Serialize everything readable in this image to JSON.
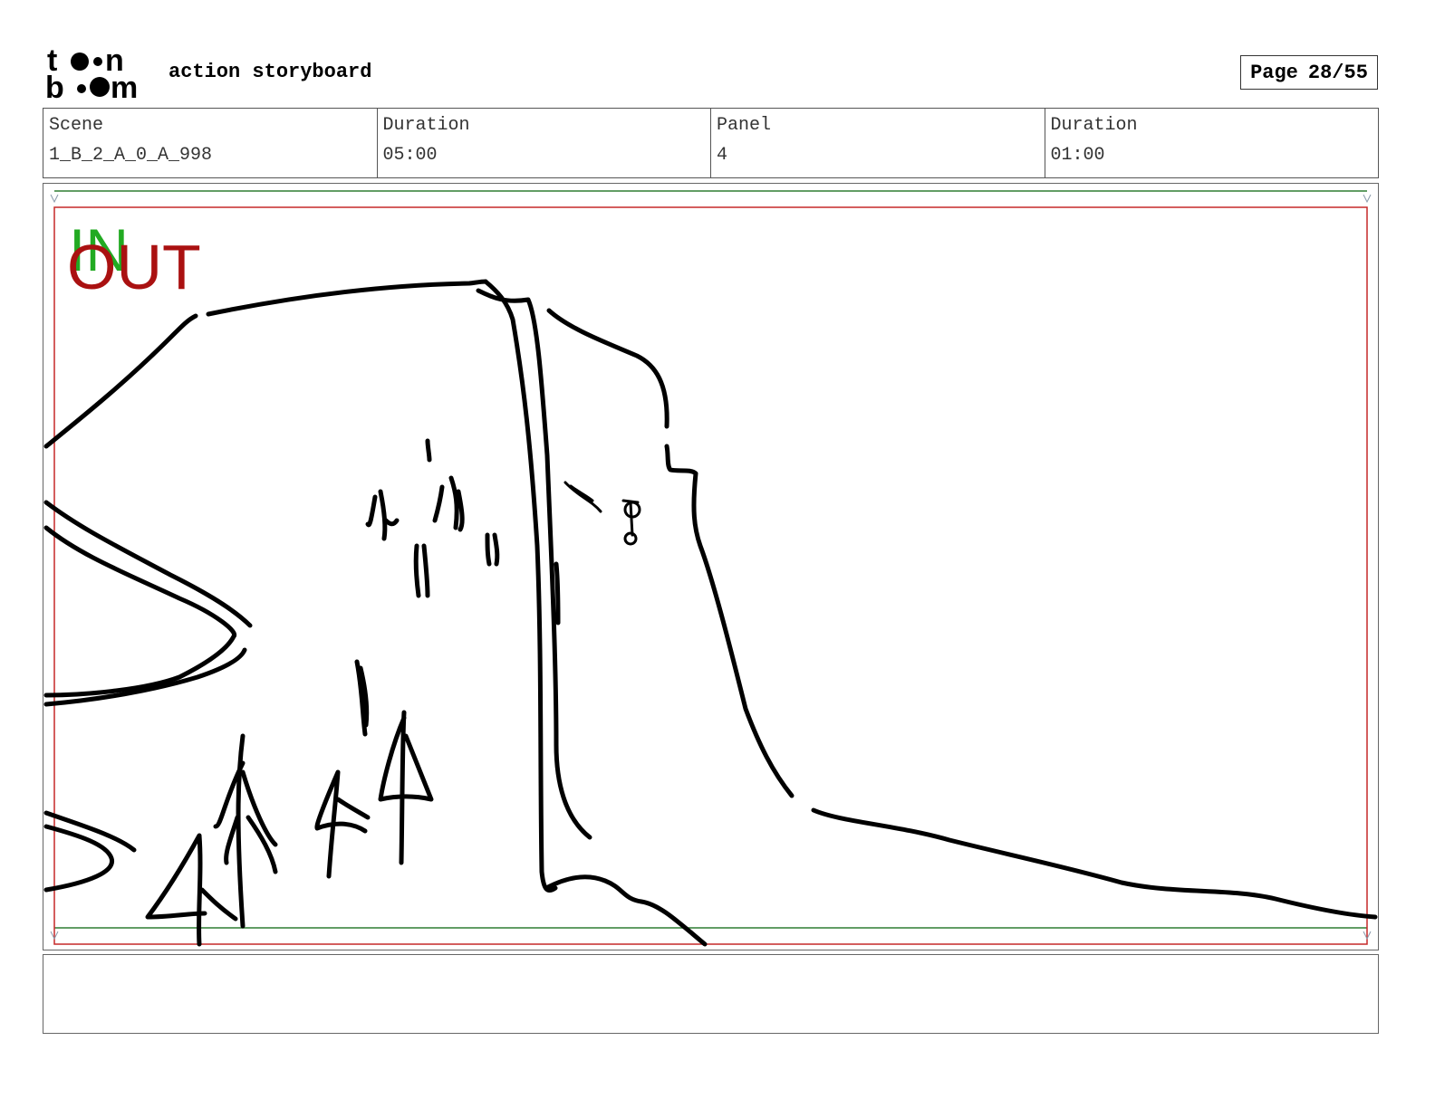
{
  "header": {
    "logo": {
      "line1": "toon",
      "line2": "boom"
    },
    "title": "action storyboard",
    "page_label": "Page",
    "page_value": "28/55"
  },
  "info": {
    "scene_label": "Scene",
    "scene_value": "1_B_2_A_0_A_998",
    "scene_duration_label": "Duration",
    "scene_duration_value": "05:00",
    "panel_label": "Panel",
    "panel_value": "4",
    "panel_duration_label": "Duration",
    "panel_duration_value": "01:00"
  },
  "panel": {
    "in_label": "IN",
    "out_label": "OUT",
    "colors": {
      "in": "#22aa22",
      "out": "#aa1111",
      "safe_frame_green": "#2e7d32",
      "safe_frame_red": "#c62828",
      "sketch": "#000000"
    }
  },
  "notes": {
    "text": ""
  }
}
